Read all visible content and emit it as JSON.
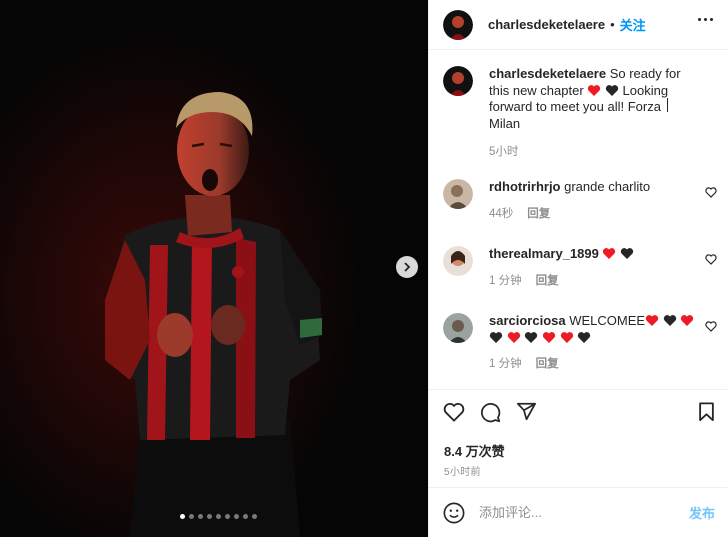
{
  "post": {
    "author": "charlesdeketelaere",
    "separator": "•",
    "follow_label": "关注",
    "caption_text_1": "So ready for this new chapter",
    "caption_text_2": "Looking forward to meet you all! Forza Milan",
    "caption_time": "5小时",
    "carousel_count": 9,
    "carousel_active_index": 0
  },
  "comments": [
    {
      "user": "rdhotrirhrjo",
      "text": "grande charlito",
      "time": "44秒",
      "reply_label": "回复"
    },
    {
      "user": "therealmary_1899",
      "text": "",
      "time": "1 分钟",
      "reply_label": "回复"
    },
    {
      "user": "sarciorciosa",
      "text": "WELCOMEE",
      "time": "1 分钟",
      "reply_label": "回复"
    }
  ],
  "actions": {
    "likes": "8.4 万次赞",
    "posted_time": "5小时前"
  },
  "add_comment": {
    "placeholder": "添加评论...",
    "post_label": "发布"
  },
  "colors": {
    "accent": "#0095f6",
    "heart_red": "#ed1c24",
    "heart_black": "#262626",
    "muted": "#8e8e8e"
  }
}
